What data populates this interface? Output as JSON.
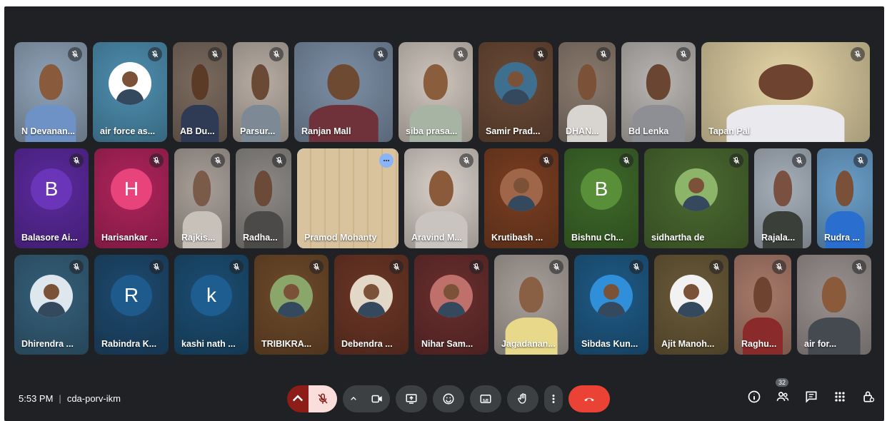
{
  "colors": {
    "stage_bg": "#202124",
    "end_call": "#ea4335",
    "mic_off_btn": "#f9dedc",
    "mic_chevron": "#8c1d18"
  },
  "meeting": {
    "time": "5:53 PM",
    "separator": "|",
    "code": "cda-porv-ikm"
  },
  "participants_count": "32",
  "rows": [
    [
      {
        "name": "N Devanan...",
        "w": 102,
        "bg": "#8fa3b8",
        "skin": "#8a5a3c",
        "shirt": "#6f92c6",
        "kind": "video"
      },
      {
        "name": "air force as...",
        "w": 104,
        "bg": "#4e8fb0",
        "kind": "avatar",
        "avatar_bg": "#ffffff"
      },
      {
        "name": "AB Du...",
        "w": 76,
        "bg": "#7a6a5e",
        "skin": "#5b3a26",
        "shirt": "#2f3a55",
        "kind": "video"
      },
      {
        "name": "Parsur...",
        "w": 78,
        "bg": "#b8ada4",
        "skin": "#6b4a35",
        "shirt": "#7d8a96",
        "kind": "video"
      },
      {
        "name": "Ranjan Mall",
        "w": 138,
        "bg": "#7d8fa6",
        "skin": "#6e4a33",
        "shirt": "#70323a",
        "kind": "video"
      },
      {
        "name": "siba prasa...",
        "w": 104,
        "bg": "#cfc6bd",
        "skin": "#8a5d3d",
        "shirt": "#a7b4a3",
        "kind": "video"
      },
      {
        "name": "Samir Prad...",
        "w": 104,
        "bg": "#6b4a36",
        "kind": "avatar",
        "avatar_bg": "#3f6f8f"
      },
      {
        "name": "DHAN...",
        "w": 80,
        "bg": "#8a7a6e",
        "skin": "#7b5238",
        "shirt": "#d8d4cf",
        "kind": "video"
      },
      {
        "name": "Bd Lenka",
        "w": 104,
        "bg": "#b9b5b2",
        "skin": "#6a4532",
        "shirt": "#8e8f94",
        "kind": "video"
      },
      {
        "name": "Tapan Pal",
        "w": 236,
        "bg": "#e6d6a8",
        "skin": "#6e4430",
        "shirt": "#e9e9ee",
        "kind": "video"
      }
    ],
    [
      {
        "name": "Balasore Ai...",
        "w": 104,
        "bg": "#5b2a9e",
        "kind": "letter",
        "letter": "B",
        "letter_bg": "#6a35b8"
      },
      {
        "name": "Harisankar ...",
        "w": 104,
        "bg": "#b0245c",
        "kind": "letter",
        "letter": "H",
        "letter_bg": "#e8437a"
      },
      {
        "name": "Rajkis...",
        "w": 78,
        "bg": "#a89f98",
        "skin": "#7a5a48",
        "shirt": "#c7c1ba",
        "kind": "video"
      },
      {
        "name": "Radha...",
        "w": 78,
        "bg": "#8c8986",
        "skin": "#6b4a38",
        "shirt": "#4b4a48",
        "kind": "video"
      },
      {
        "name": "Pramod Mohanty",
        "w": 142,
        "bg": "#d7c09a",
        "kind": "empty",
        "selected": true
      },
      {
        "name": "Aravind M...",
        "w": 104,
        "bg": "#d8cfc8",
        "skin": "#8a5a3a",
        "shirt": "#c9c4c0",
        "kind": "video"
      },
      {
        "name": "Krutibash ...",
        "w": 104,
        "bg": "#7a3e22",
        "kind": "avatar",
        "avatar_bg": "#a0664a"
      },
      {
        "name": "Bishnu Ch...",
        "w": 104,
        "bg": "#3e6a2a",
        "kind": "letter",
        "letter": "B",
        "letter_bg": "#5a8f3a"
      },
      {
        "name": "sidhartha de",
        "w": 146,
        "bg": "#4b6a30",
        "kind": "avatar",
        "avatar_bg": "#8cb56a"
      },
      {
        "name": "Rajala...",
        "w": 80,
        "bg": "#a6b0ba",
        "skin": "#7a5040",
        "shirt": "#3a3f3a",
        "kind": "video"
      },
      {
        "name": "Rudra ...",
        "w": 78,
        "bg": "#6a9ec9",
        "skin": "#7a5038",
        "shirt": "#2a6fd0",
        "kind": "video"
      }
    ],
    [
      {
        "name": "Dhirendra ...",
        "w": 104,
        "bg": "#35607a",
        "kind": "avatar",
        "avatar_bg": "#dfe7ee"
      },
      {
        "name": "Rabindra K...",
        "w": 104,
        "bg": "#1e4a6e",
        "kind": "letter",
        "letter": "R",
        "letter_bg": "#1f5a8c"
      },
      {
        "name": "kashi nath ...",
        "w": 104,
        "bg": "#1c4e72",
        "kind": "letter",
        "letter": "k",
        "letter_bg": "#1d5d8f"
      },
      {
        "name": "TRIBIKRA...",
        "w": 104,
        "bg": "#6e4a2a",
        "kind": "avatar",
        "avatar_bg": "#8aa66a"
      },
      {
        "name": "Debendra ...",
        "w": 104,
        "bg": "#6b3626",
        "kind": "avatar",
        "avatar_bg": "#e3d8c8"
      },
      {
        "name": "Nihar Sam...",
        "w": 104,
        "bg": "#6a2e2e",
        "kind": "avatar",
        "avatar_bg": "#c0706a"
      },
      {
        "name": "Jagadanan...",
        "w": 104,
        "bg": "#a8a09a",
        "skin": "#8a6044",
        "shirt": "#e8d98a",
        "kind": "video"
      },
      {
        "name": "Sibdas Kun...",
        "w": 104,
        "bg": "#1f5a86",
        "kind": "avatar",
        "avatar_bg": "#2f8fd8"
      },
      {
        "name": "Ajit Manoh...",
        "w": 104,
        "bg": "#6a5a38",
        "kind": "avatar",
        "avatar_bg": "#f2f2f2"
      },
      {
        "name": "Raghu...",
        "w": 80,
        "bg": "#a87a6a",
        "skin": "#6e4430",
        "shirt": "#8a2a2a",
        "kind": "video"
      },
      {
        "name": "air for...",
        "w": 104,
        "bg": "#9a9290",
        "skin": "#8a5a3a",
        "shirt": "#454a50",
        "kind": "video"
      }
    ]
  ],
  "mic_tints": [
    "#5f6368",
    "#2b6d8f",
    "#5f6368",
    "#5f6368",
    "#5f6368",
    "#5f6368",
    "#a0522d",
    "#5f6368",
    "#5f6368",
    "#5f6368"
  ],
  "icons": {
    "mic_off": "mic-off-icon",
    "camera": "camera-icon",
    "present": "present-icon",
    "emoji": "emoji-icon",
    "captions": "captions-icon",
    "hand": "raise-hand-icon",
    "more": "more-vert-icon",
    "end": "end-call-icon",
    "info": "info-icon",
    "people": "people-icon",
    "chat": "chat-icon",
    "activities": "activities-icon",
    "host": "host-controls-icon"
  }
}
